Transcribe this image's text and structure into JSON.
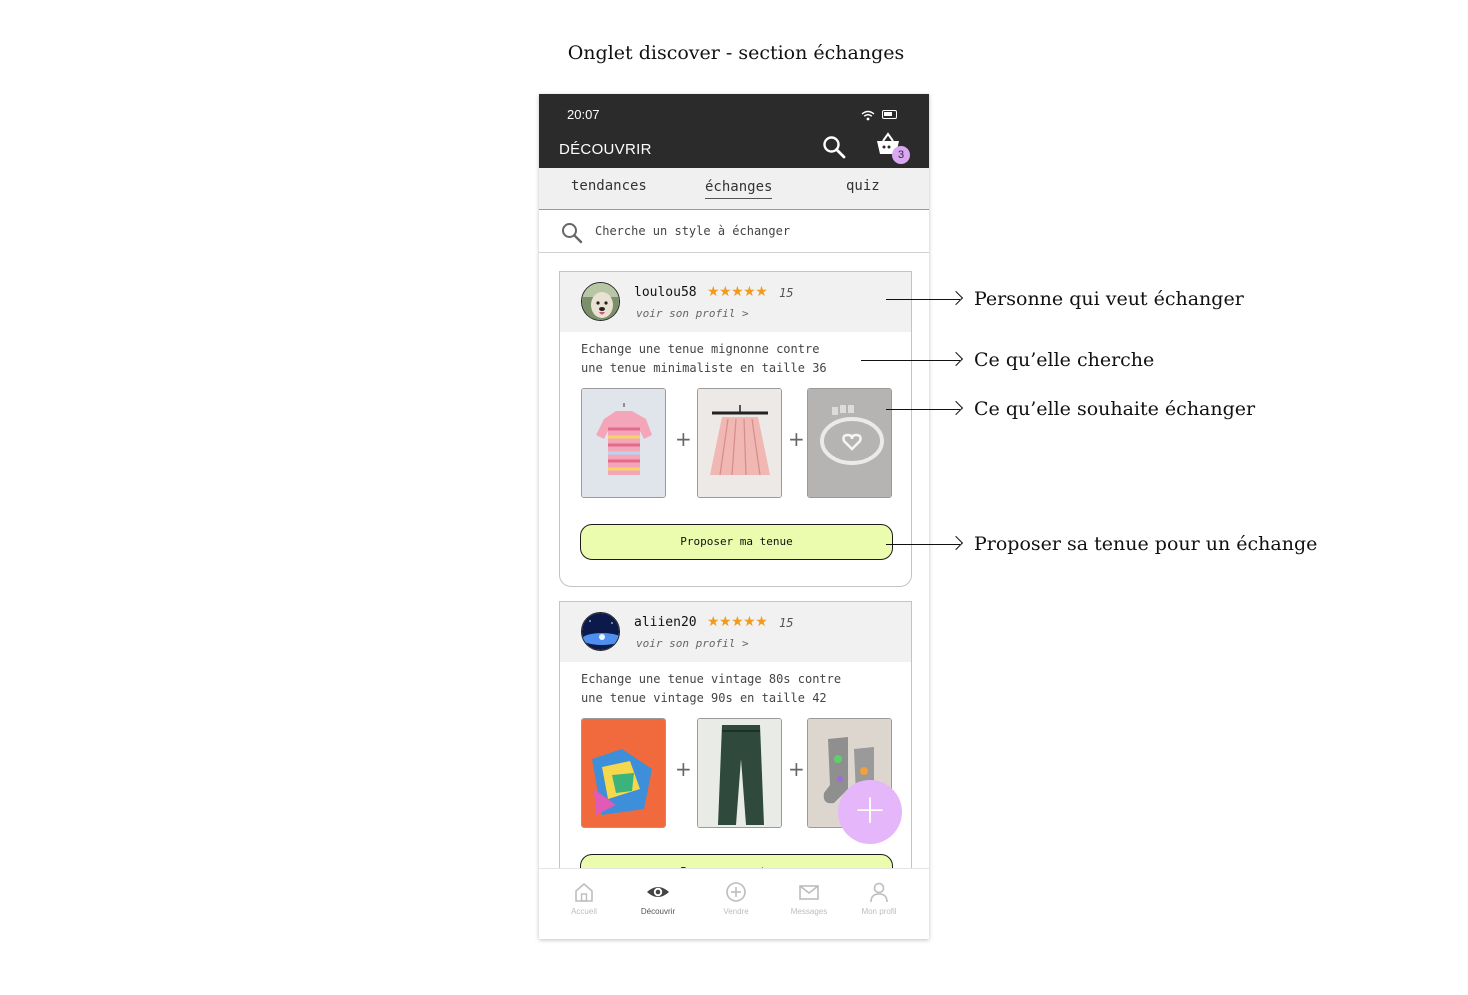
{
  "page_title": "Onglet discover - section échanges",
  "status_bar": {
    "time": "20:07"
  },
  "app_bar": {
    "title": "DÉCOUVRIR",
    "cart_count": "3"
  },
  "tabs": [
    {
      "label": "tendances",
      "active": false
    },
    {
      "label": "échanges",
      "active": true
    },
    {
      "label": "quiz",
      "active": false
    }
  ],
  "search": {
    "placeholder": "Cherche un style à échanger"
  },
  "listings": [
    {
      "username": "loulou58",
      "stars": "★★★★★",
      "review_count": "15",
      "profile_link": "voir son profil >",
      "description": "Echange une tenue mignonne contre\nune tenue minimaliste en taille 36",
      "items": [
        "striped-pink-tshirt",
        "pink-pleated-skirt",
        "heart-bracelet"
      ],
      "button_label": "Proposer ma tenue"
    },
    {
      "username": "aliien20",
      "stars": "★★★★★",
      "review_count": "15",
      "profile_link": "voir son profil >",
      "description": "Echange une tenue vintage 80s contre\nune tenue vintage 90s en taille 42",
      "items": [
        "orange-printed-tshirt",
        "green-trousers",
        "grey-socks"
      ],
      "button_label": "Proposer ma tenue"
    }
  ],
  "fab": {
    "label": "+"
  },
  "bottom_nav": [
    {
      "label": "Accueil",
      "icon": "home-icon",
      "active": false
    },
    {
      "label": "Découvrir",
      "icon": "eye-icon",
      "active": true
    },
    {
      "label": "Vendre",
      "icon": "plus-circle-icon",
      "active": false
    },
    {
      "label": "Messages",
      "icon": "mail-icon",
      "active": false
    },
    {
      "label": "Mon profil",
      "icon": "user-icon",
      "active": false
    }
  ],
  "annotations": [
    "Personne qui veut échanger",
    "Ce qu’elle cherche",
    "Ce qu’elle souhaite échanger",
    "Proposer sa tenue pour un échange"
  ],
  "colors": {
    "top_bar": "#2b2b2b",
    "accent_purple": "#e6b6fb",
    "button_green": "#ecfcae",
    "star_orange": "#f29a1a"
  }
}
